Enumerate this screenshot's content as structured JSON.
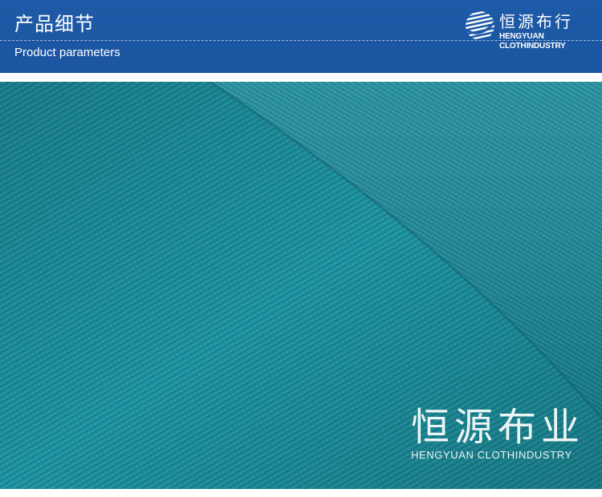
{
  "header": {
    "title": "产品细节",
    "subtitle": "Product parameters"
  },
  "logo": {
    "name_cn": "恒源布行",
    "name_en": "HENGYUAN CLOTHINDUSTRY",
    "icon": "striped-globe-icon"
  },
  "photo": {
    "subject": "teal knit fabric close-up",
    "color": "#1e8e9c"
  },
  "watermark": {
    "name_cn": "恒源布业",
    "name_en": "HENGYUAN CLOTHINDUSTRY"
  },
  "colors": {
    "header_bg": "#1e5aa7",
    "fabric": "#1e8e9c",
    "text": "#ffffff"
  }
}
